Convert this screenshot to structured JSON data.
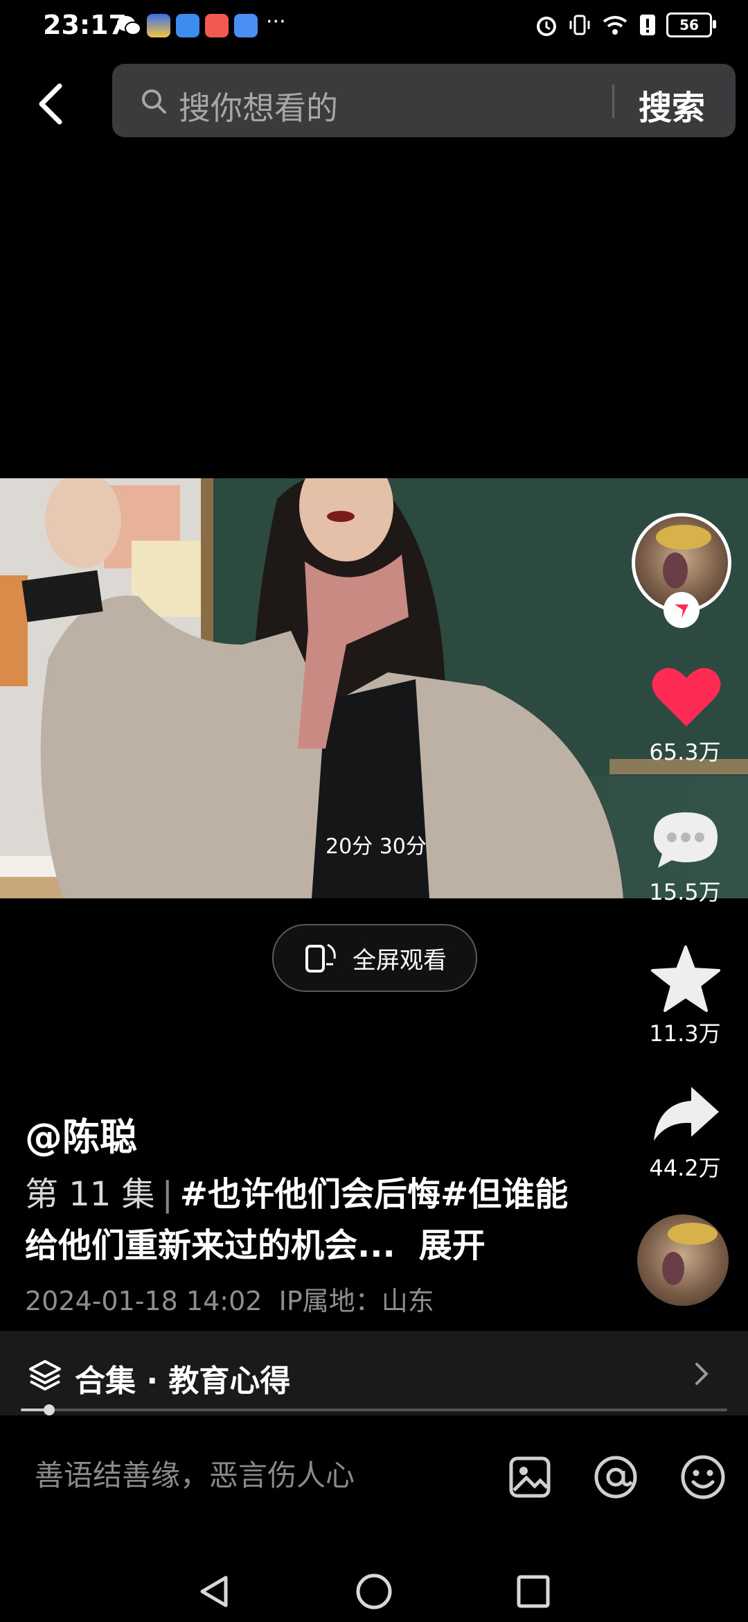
{
  "status": {
    "time": "23:17",
    "battery": "56"
  },
  "search": {
    "placeholder": "搜你想看的",
    "button": "搜索"
  },
  "video": {
    "time_overlay": "20分 30分",
    "fullscreen_label": "全屏观看"
  },
  "rail": {
    "likes": "65.3万",
    "comments": "15.5万",
    "favorites": "11.3万",
    "shares": "44.2万"
  },
  "post": {
    "author": "@陈聪",
    "episode": "第 11 集",
    "episode_sep": "|",
    "hashtag1": "#也许他们会后悔",
    "hashtag2": "#但谁能给他们重新来过的机会...",
    "expand": "展开",
    "date": "2024-01-18 14:02",
    "ip": "IP属地：山东"
  },
  "collection": {
    "label": "合集 · 教育心得",
    "progress": 0.04
  },
  "comment": {
    "placeholder": "善语结善缘，恶言伤人心"
  },
  "colors": {
    "like": "#fe2c55",
    "background": "#000000",
    "search_bg": "#3b3b3d"
  }
}
